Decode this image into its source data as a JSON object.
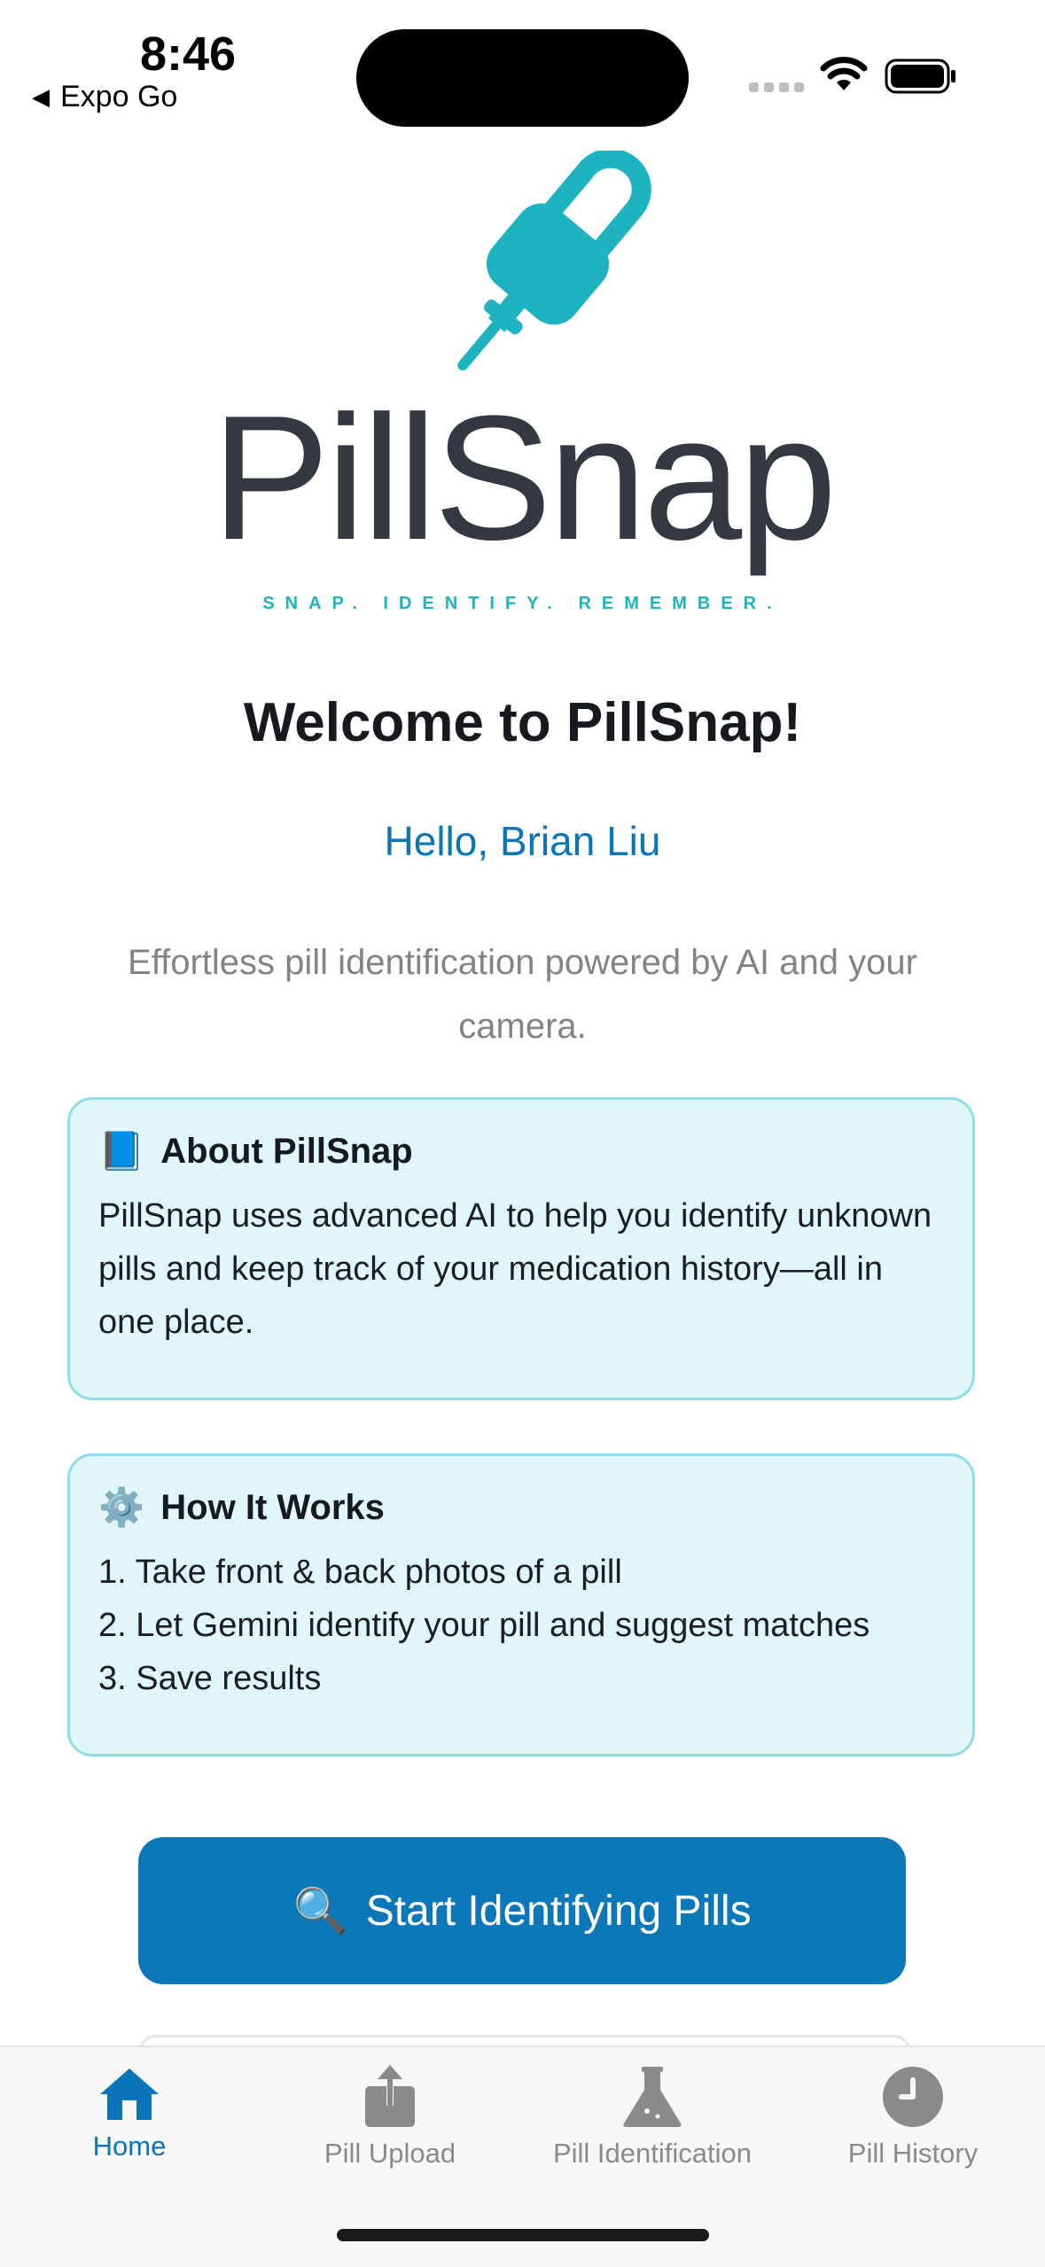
{
  "status_bar": {
    "time": "8:46",
    "back_app": "Expo Go",
    "back_icon": "back-triangle-icon"
  },
  "logo": {
    "wordmark": "PillSnap",
    "tagline": "SNAP. IDENTIFY. REMEMBER.",
    "brand_color": "#1db3c0",
    "text_color": "#333842"
  },
  "welcome": {
    "title": "Welcome to PillSnap!",
    "greeting": "Hello, Brian Liu",
    "subtitle": "Effortless pill identification powered by AI and your camera."
  },
  "cards": {
    "about": {
      "icon": "📘",
      "title": "About PillSnap",
      "body": "PillSnap uses advanced AI to help you identify unknown pills and keep track of your medication history—all in one place."
    },
    "how": {
      "icon": "⚙️",
      "title": "How It Works",
      "steps": [
        "1. Take front & back photos of a pill",
        "2. Let Gemini identify your pill and suggest matches",
        "3. Save results"
      ]
    }
  },
  "cta": {
    "icon": "🔍",
    "label": "Start Identifying Pills",
    "color": "#0a77b8"
  },
  "tabs": [
    {
      "label": "Home",
      "icon": "home-icon",
      "active": true
    },
    {
      "label": "Pill Upload",
      "icon": "upload-icon",
      "active": false
    },
    {
      "label": "Pill Identification",
      "icon": "flask-icon",
      "active": false
    },
    {
      "label": "Pill History",
      "icon": "clock-icon",
      "active": false
    }
  ]
}
